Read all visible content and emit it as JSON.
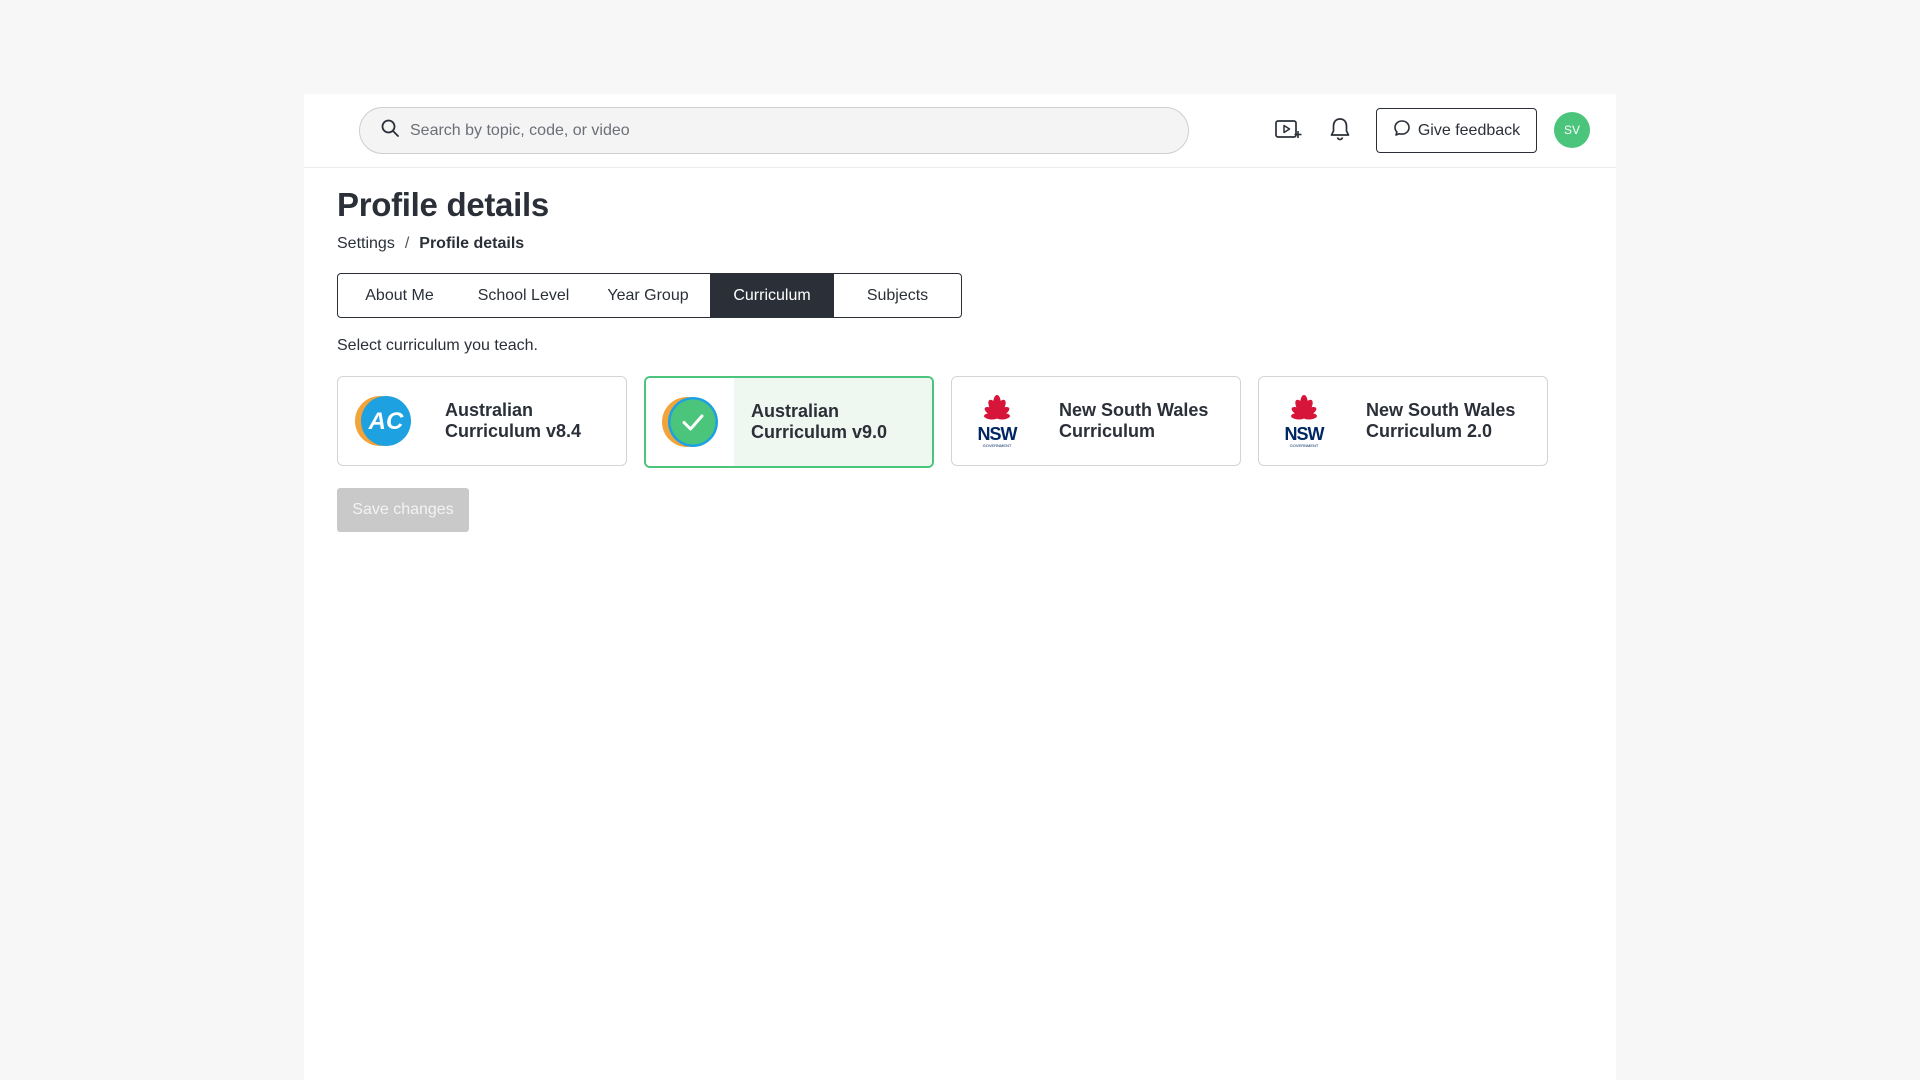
{
  "header": {
    "search_placeholder": "Search by topic, code, or video",
    "search_value": "",
    "feedback_label": "Give feedback",
    "avatar_initials": "SV"
  },
  "page": {
    "title": "Profile details",
    "breadcrumb": {
      "parent": "Settings",
      "separator": "/",
      "current": "Profile details"
    }
  },
  "tabs": [
    {
      "label": "About Me",
      "active": false
    },
    {
      "label": "School Level",
      "active": false
    },
    {
      "label": "Year Group",
      "active": false
    },
    {
      "label": "Curriculum",
      "active": true
    },
    {
      "label": "Subjects",
      "active": false
    }
  ],
  "curriculum": {
    "instruction": "Select curriculum you teach.",
    "options": [
      {
        "label": "Australian Curriculum v8.4",
        "logo": "ac-logo",
        "selected": false
      },
      {
        "label": "Australian Curriculum v9.0",
        "logo": "check-icon",
        "selected": true
      },
      {
        "label": "New South Wales Curriculum",
        "logo": "nsw-government-logo",
        "selected": false
      },
      {
        "label": "New South Wales Curriculum 2.0",
        "logo": "nsw-government-logo",
        "selected": false
      }
    ],
    "save_label": "Save changes",
    "save_disabled": true
  },
  "colors": {
    "accent_green": "#4cc57c",
    "dark": "#2b3038",
    "ac_blue": "#1da1e0",
    "ac_orange": "#f2a33a",
    "nsw_red": "#d7153a",
    "nsw_navy": "#002664"
  }
}
